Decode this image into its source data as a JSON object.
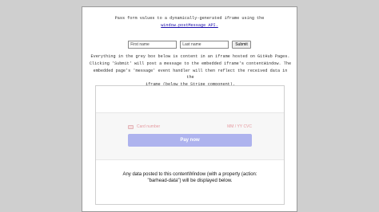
{
  "intro": {
    "line1": "Pass form values to a dynamically-generated iframe using the",
    "api_link": "window.postMessage API."
  },
  "form": {
    "first_name_placeholder": "First name",
    "last_name_placeholder": "Last name",
    "submit_label": "Submit"
  },
  "description": [
    "Everything in the grey box below is content in an iframe hosted on GitHub Pages.",
    "Clicking 'Submit' will post a message to the embedded iframe's contentWindow. The",
    "embedded page's 'message' event handler will then reflect the received data in the",
    "iframe (below the Stripe component)."
  ],
  "stripe": {
    "card_placeholder": "Card number",
    "expiry_cvc_placeholder": "MM / YY  CVC",
    "pay_label": "Pay now",
    "pay_color": "#aeb3ee"
  },
  "iframe_note": {
    "line1": "Any data posted to this contentWindow (with a property (action:",
    "line2": "\"barhead-data\") will be displayed below."
  }
}
